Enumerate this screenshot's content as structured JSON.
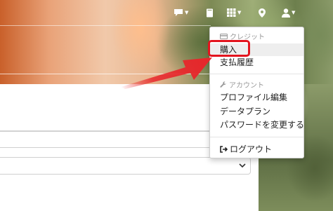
{
  "colors": {
    "highlight": "#e3141e",
    "arrow": "#e8262b",
    "menu_header": "#9a9a9a",
    "menu_text": "#222222",
    "active_row": "#eeeeee"
  },
  "navbar": {
    "items": [
      {
        "icon": "chat-icon",
        "has_caret": true
      },
      {
        "icon": "book-icon",
        "has_caret": false
      },
      {
        "icon": "grid-icon",
        "has_caret": true
      },
      {
        "icon": "map-pin-icon",
        "has_caret": false
      },
      {
        "icon": "user-icon",
        "has_caret": true
      }
    ]
  },
  "menu": {
    "credit_header": "クレジット",
    "credit_header_icon": "credit-card-icon",
    "credit_items": [
      "購入",
      "支払履歴"
    ],
    "account_header": "アカウント",
    "account_header_icon": "wrench-icon",
    "account_items": [
      "プロファイル編集",
      "データプラン",
      "パスワードを変更する"
    ],
    "logout_icon": "logout-icon",
    "logout_label": "ログアウト",
    "highlighted_item": "購入"
  }
}
